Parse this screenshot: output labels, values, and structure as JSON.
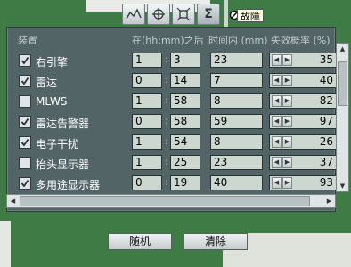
{
  "toolbar": {
    "buttons": [
      {
        "icon": "wave-icon",
        "glyph": "∩",
        "active": false
      },
      {
        "icon": "crosshair-icon",
        "glyph": "⌖",
        "active": false
      },
      {
        "icon": "target-icon",
        "glyph": "⌖",
        "active": false
      },
      {
        "icon": "sigma-icon",
        "glyph": "Σ",
        "active": true
      }
    ],
    "tooltip": "故障"
  },
  "header": {
    "device": "装置",
    "after": "在(hh:mm)之后",
    "within": "时间内 (mm)",
    "probability": "失效概率 (%)"
  },
  "rows": [
    {
      "name": "右引擎",
      "checked": true,
      "hh": "1",
      "mm": "3",
      "duration": "23",
      "probability": "35"
    },
    {
      "name": "雷达",
      "checked": true,
      "hh": "0",
      "mm": "14",
      "duration": "7",
      "probability": "40"
    },
    {
      "name": "MLWS",
      "checked": false,
      "hh": "1",
      "mm": "58",
      "duration": "8",
      "probability": "82"
    },
    {
      "name": "雷达告警器",
      "checked": true,
      "hh": "0",
      "mm": "58",
      "duration": "59",
      "probability": "97"
    },
    {
      "name": "电子干扰",
      "checked": true,
      "hh": "1",
      "mm": "54",
      "duration": "8",
      "probability": "26"
    },
    {
      "name": "抬头显示器",
      "checked": false,
      "hh": "1",
      "mm": "25",
      "duration": "23",
      "probability": "37"
    },
    {
      "name": "多用途显示器",
      "checked": true,
      "hh": "0",
      "mm": "19",
      "duration": "40",
      "probability": "93"
    }
  ],
  "footer": {
    "random_label": "随机",
    "clear_label": "清除"
  },
  "colors": {
    "background_map": "#3f7c45",
    "panel": "#536467",
    "field": "#ccd8cf"
  }
}
